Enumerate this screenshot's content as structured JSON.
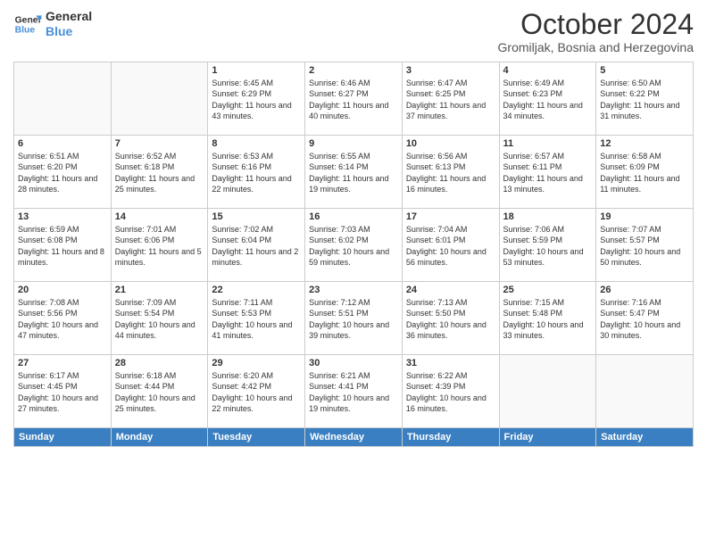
{
  "header": {
    "logo_line1": "General",
    "logo_line2": "Blue",
    "title": "October 2024",
    "subtitle": "Gromiljak, Bosnia and Herzegovina"
  },
  "calendar": {
    "days_of_week": [
      "Sunday",
      "Monday",
      "Tuesday",
      "Wednesday",
      "Thursday",
      "Friday",
      "Saturday"
    ],
    "weeks": [
      [
        {
          "day": "",
          "info": ""
        },
        {
          "day": "",
          "info": ""
        },
        {
          "day": "1",
          "info": "Sunrise: 6:45 AM\nSunset: 6:29 PM\nDaylight: 11 hours and 43 minutes."
        },
        {
          "day": "2",
          "info": "Sunrise: 6:46 AM\nSunset: 6:27 PM\nDaylight: 11 hours and 40 minutes."
        },
        {
          "day": "3",
          "info": "Sunrise: 6:47 AM\nSunset: 6:25 PM\nDaylight: 11 hours and 37 minutes."
        },
        {
          "day": "4",
          "info": "Sunrise: 6:49 AM\nSunset: 6:23 PM\nDaylight: 11 hours and 34 minutes."
        },
        {
          "day": "5",
          "info": "Sunrise: 6:50 AM\nSunset: 6:22 PM\nDaylight: 11 hours and 31 minutes."
        }
      ],
      [
        {
          "day": "6",
          "info": "Sunrise: 6:51 AM\nSunset: 6:20 PM\nDaylight: 11 hours and 28 minutes."
        },
        {
          "day": "7",
          "info": "Sunrise: 6:52 AM\nSunset: 6:18 PM\nDaylight: 11 hours and 25 minutes."
        },
        {
          "day": "8",
          "info": "Sunrise: 6:53 AM\nSunset: 6:16 PM\nDaylight: 11 hours and 22 minutes."
        },
        {
          "day": "9",
          "info": "Sunrise: 6:55 AM\nSunset: 6:14 PM\nDaylight: 11 hours and 19 minutes."
        },
        {
          "day": "10",
          "info": "Sunrise: 6:56 AM\nSunset: 6:13 PM\nDaylight: 11 hours and 16 minutes."
        },
        {
          "day": "11",
          "info": "Sunrise: 6:57 AM\nSunset: 6:11 PM\nDaylight: 11 hours and 13 minutes."
        },
        {
          "day": "12",
          "info": "Sunrise: 6:58 AM\nSunset: 6:09 PM\nDaylight: 11 hours and 11 minutes."
        }
      ],
      [
        {
          "day": "13",
          "info": "Sunrise: 6:59 AM\nSunset: 6:08 PM\nDaylight: 11 hours and 8 minutes."
        },
        {
          "day": "14",
          "info": "Sunrise: 7:01 AM\nSunset: 6:06 PM\nDaylight: 11 hours and 5 minutes."
        },
        {
          "day": "15",
          "info": "Sunrise: 7:02 AM\nSunset: 6:04 PM\nDaylight: 11 hours and 2 minutes."
        },
        {
          "day": "16",
          "info": "Sunrise: 7:03 AM\nSunset: 6:02 PM\nDaylight: 10 hours and 59 minutes."
        },
        {
          "day": "17",
          "info": "Sunrise: 7:04 AM\nSunset: 6:01 PM\nDaylight: 10 hours and 56 minutes."
        },
        {
          "day": "18",
          "info": "Sunrise: 7:06 AM\nSunset: 5:59 PM\nDaylight: 10 hours and 53 minutes."
        },
        {
          "day": "19",
          "info": "Sunrise: 7:07 AM\nSunset: 5:57 PM\nDaylight: 10 hours and 50 minutes."
        }
      ],
      [
        {
          "day": "20",
          "info": "Sunrise: 7:08 AM\nSunset: 5:56 PM\nDaylight: 10 hours and 47 minutes."
        },
        {
          "day": "21",
          "info": "Sunrise: 7:09 AM\nSunset: 5:54 PM\nDaylight: 10 hours and 44 minutes."
        },
        {
          "day": "22",
          "info": "Sunrise: 7:11 AM\nSunset: 5:53 PM\nDaylight: 10 hours and 41 minutes."
        },
        {
          "day": "23",
          "info": "Sunrise: 7:12 AM\nSunset: 5:51 PM\nDaylight: 10 hours and 39 minutes."
        },
        {
          "day": "24",
          "info": "Sunrise: 7:13 AM\nSunset: 5:50 PM\nDaylight: 10 hours and 36 minutes."
        },
        {
          "day": "25",
          "info": "Sunrise: 7:15 AM\nSunset: 5:48 PM\nDaylight: 10 hours and 33 minutes."
        },
        {
          "day": "26",
          "info": "Sunrise: 7:16 AM\nSunset: 5:47 PM\nDaylight: 10 hours and 30 minutes."
        }
      ],
      [
        {
          "day": "27",
          "info": "Sunrise: 6:17 AM\nSunset: 4:45 PM\nDaylight: 10 hours and 27 minutes."
        },
        {
          "day": "28",
          "info": "Sunrise: 6:18 AM\nSunset: 4:44 PM\nDaylight: 10 hours and 25 minutes."
        },
        {
          "day": "29",
          "info": "Sunrise: 6:20 AM\nSunset: 4:42 PM\nDaylight: 10 hours and 22 minutes."
        },
        {
          "day": "30",
          "info": "Sunrise: 6:21 AM\nSunset: 4:41 PM\nDaylight: 10 hours and 19 minutes."
        },
        {
          "day": "31",
          "info": "Sunrise: 6:22 AM\nSunset: 4:39 PM\nDaylight: 10 hours and 16 minutes."
        },
        {
          "day": "",
          "info": ""
        },
        {
          "day": "",
          "info": ""
        }
      ]
    ]
  }
}
